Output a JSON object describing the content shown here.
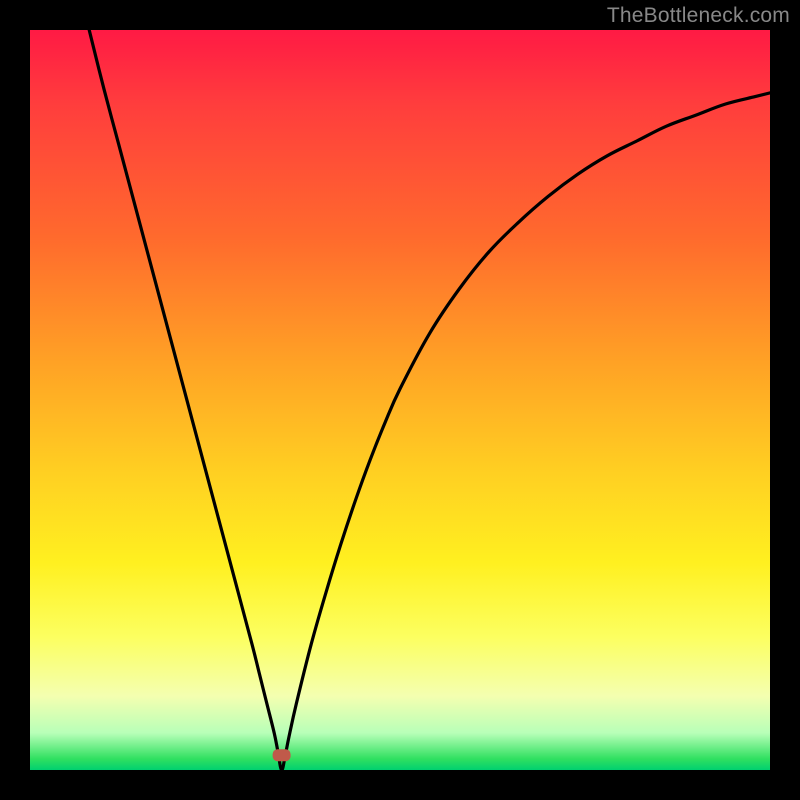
{
  "watermark": "TheBottleneck.com",
  "chart_data": {
    "type": "line",
    "title": "",
    "xlabel": "",
    "ylabel": "",
    "xlim": [
      0,
      100
    ],
    "ylim": [
      0,
      100
    ],
    "background_gradient_meaning": "bottleneck severity (red=high, green=low)",
    "minimum": {
      "x": 34,
      "y": 0
    },
    "marker": {
      "x": 34,
      "y": 2,
      "color": "#c05a4a",
      "shape": "rounded-rect"
    },
    "series": [
      {
        "name": "bottleneck-curve",
        "x": [
          8,
          10,
          12,
          14,
          16,
          18,
          20,
          22,
          24,
          26,
          28,
          30,
          31,
          32,
          33,
          33.5,
          34,
          34.5,
          35,
          36,
          38,
          40,
          42,
          44,
          46,
          48,
          50,
          54,
          58,
          62,
          66,
          70,
          74,
          78,
          82,
          86,
          90,
          94,
          98,
          100
        ],
        "y": [
          100,
          92,
          84.5,
          77,
          69.5,
          62,
          54.5,
          47,
          39.5,
          32,
          24.5,
          17,
          13,
          9,
          5,
          2.5,
          0,
          2,
          4.5,
          9,
          17,
          24,
          30.5,
          36.5,
          42,
          47,
          51.5,
          59,
          65,
          70,
          74,
          77.5,
          80.5,
          83,
          85,
          87,
          88.5,
          90,
          91,
          91.5
        ]
      }
    ]
  },
  "colors": {
    "curve": "#000000",
    "frame": "#000000",
    "marker": "#c05a4a"
  }
}
